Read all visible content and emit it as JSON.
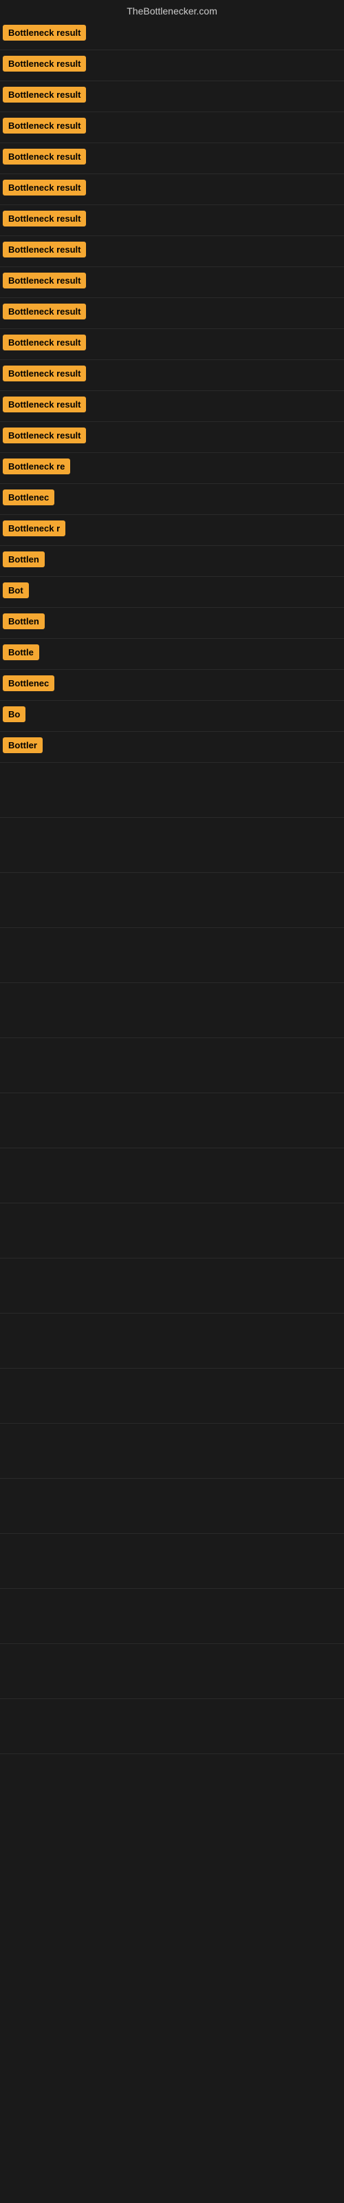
{
  "header": {
    "title": "TheBottlenecker.com"
  },
  "rows": [
    {
      "id": 1,
      "label": "Bottleneck result",
      "visible_width": "full"
    },
    {
      "id": 2,
      "label": "Bottleneck result",
      "visible_width": "full"
    },
    {
      "id": 3,
      "label": "Bottleneck result",
      "visible_width": "full"
    },
    {
      "id": 4,
      "label": "Bottleneck result",
      "visible_width": "full"
    },
    {
      "id": 5,
      "label": "Bottleneck result",
      "visible_width": "full"
    },
    {
      "id": 6,
      "label": "Bottleneck result",
      "visible_width": "full"
    },
    {
      "id": 7,
      "label": "Bottleneck result",
      "visible_width": "full"
    },
    {
      "id": 8,
      "label": "Bottleneck result",
      "visible_width": "full"
    },
    {
      "id": 9,
      "label": "Bottleneck result",
      "visible_width": "full"
    },
    {
      "id": 10,
      "label": "Bottleneck result",
      "visible_width": "full"
    },
    {
      "id": 11,
      "label": "Bottleneck result",
      "visible_width": "full"
    },
    {
      "id": 12,
      "label": "Bottleneck result",
      "visible_width": "full"
    },
    {
      "id": 13,
      "label": "Bottleneck result",
      "visible_width": "full"
    },
    {
      "id": 14,
      "label": "Bottleneck result",
      "visible_width": "full"
    },
    {
      "id": 15,
      "label": "Bottleneck re",
      "visible_width": "partial-lg"
    },
    {
      "id": 16,
      "label": "Bottlenec",
      "visible_width": "partial-md"
    },
    {
      "id": 17,
      "label": "Bottleneck r",
      "visible_width": "partial-lg2"
    },
    {
      "id": 18,
      "label": "Bottlen",
      "visible_width": "partial-sm"
    },
    {
      "id": 19,
      "label": "Bot",
      "visible_width": "partial-xs"
    },
    {
      "id": 20,
      "label": "Bottlen",
      "visible_width": "partial-sm"
    },
    {
      "id": 21,
      "label": "Bottle",
      "visible_width": "partial-sm2"
    },
    {
      "id": 22,
      "label": "Bottlenec",
      "visible_width": "partial-md"
    },
    {
      "id": 23,
      "label": "Bo",
      "visible_width": "partial-xxs"
    },
    {
      "id": 24,
      "label": "Bottler",
      "visible_width": "partial-xs2"
    }
  ],
  "colors": {
    "tag_bg": "#f5a832",
    "tag_text": "#000000",
    "page_bg": "#1a1a1a",
    "header_text": "#cccccc"
  }
}
